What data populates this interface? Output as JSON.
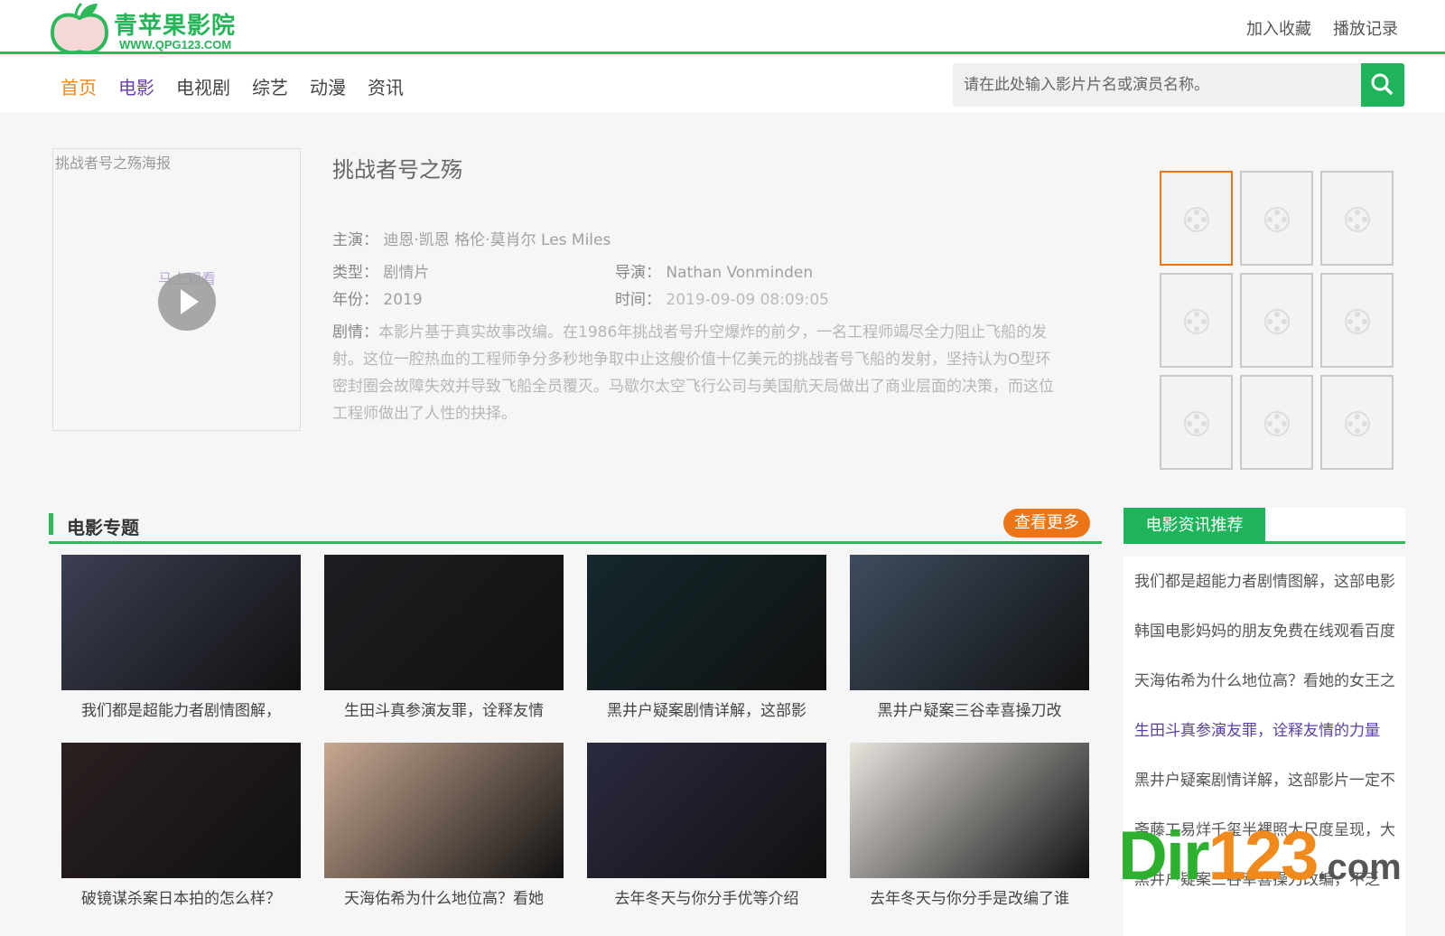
{
  "header": {
    "logo_title": "青苹果影院",
    "logo_url": "WWW.QPG123.COM",
    "links": [
      "加入收藏",
      "播放记录"
    ]
  },
  "nav": {
    "items": [
      "首页",
      "电影",
      "电视剧",
      "综艺",
      "动漫",
      "资讯"
    ]
  },
  "search": {
    "placeholder": "请在此处输入影片片名或演员名称。",
    "icon": "search-icon"
  },
  "movie": {
    "poster_alt": "挑战者号之殇海报",
    "watch_now": "马上观看",
    "title": "挑战者号之殇",
    "cast_label": "主演：",
    "cast": "迪恩·凯恩  格伦·莫肖尔  Les  Miles",
    "genre_label": "类型：",
    "genre": "剧情片",
    "director_label": "导演：",
    "director": "Nathan  Vonminden",
    "year_label": "年份：",
    "year": "2019",
    "time_label": "时间：",
    "time": "2019-09-09 08:09:05",
    "plot_label": "剧情：",
    "plot": "本影片基于真实故事改编。在1986年挑战者号升空爆炸的前夕，一名工程师竭尽全力阻止飞船的发射。这位一腔热血的工程师争分多秒地争取中止这艘价值十亿美元的挑战者号飞船的发射，坚持认为O型环密封圈会故障失效并导致飞船全员覆灭。马歇尔太空飞行公司与美国航天局做出了商业层面的决策，而这位工程师做出了人性的抉择。"
  },
  "topics": {
    "title": "电影专题",
    "more": "查看更多",
    "cards": [
      {
        "caption": "我们都是超能力者剧情图解，",
        "color": "#3b3f52"
      },
      {
        "caption": "生田斗真参演友罪，诠释友情",
        "color": "#1e1e22"
      },
      {
        "caption": "黑井户疑案剧情详解，这部影",
        "color": "#14282c"
      },
      {
        "caption": "黑井户疑案三谷幸喜操刀改",
        "color": "#3d4c5e"
      },
      {
        "caption": "破镜谋杀案日本拍的怎么样？",
        "color": "#2a2020"
      },
      {
        "caption": "天海佑希为什么地位高？看她",
        "color": "#c8a892"
      },
      {
        "caption": "去年冬天与你分手优等介绍",
        "color": "#2a2a40"
      },
      {
        "caption": "去年冬天与你分手是改编了谁",
        "color": "#e8e4de"
      }
    ]
  },
  "news": {
    "tab": "电影资讯推荐",
    "items": [
      "我们都是超能力者剧情图解，这部电影",
      "韩国电影妈妈的朋友免费在线观看百度",
      "天海佑希为什么地位高？看她的女王之",
      "生田斗真参演友罪，诠释友情的力量",
      "黑井户疑案剧情详解，这部影片一定不",
      "斋藤工易烊千玺半裸照大尺度呈现，大",
      "黑井户疑案三谷幸喜操刀改编，不乏"
    ]
  },
  "watermark": {
    "dir": "Dir",
    "num": "123",
    "com": ".com"
  }
}
